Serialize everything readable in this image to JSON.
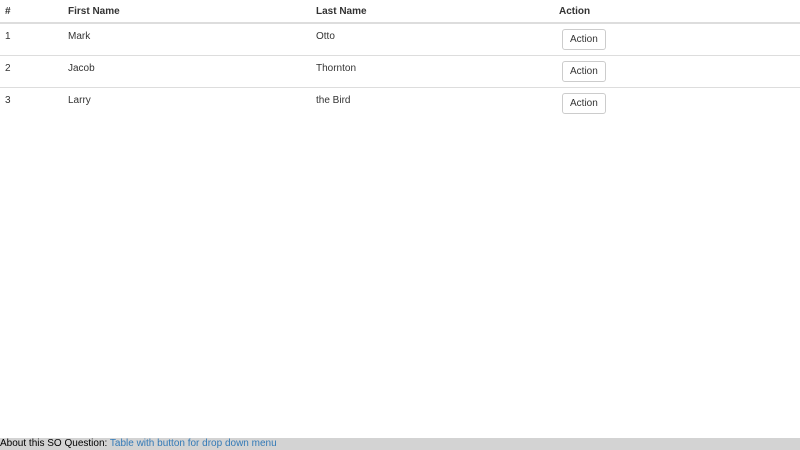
{
  "table": {
    "headers": {
      "number": "#",
      "first_name": "First Name",
      "last_name": "Last Name",
      "action": "Action"
    },
    "rows": [
      {
        "number": "1",
        "first_name": "Mark",
        "last_name": "Otto",
        "action_label": "Action"
      },
      {
        "number": "2",
        "first_name": "Jacob",
        "last_name": "Thornton",
        "action_label": "Action"
      },
      {
        "number": "3",
        "first_name": "Larry",
        "last_name": "the Bird",
        "action_label": "Action"
      }
    ]
  },
  "footer": {
    "prefix": "About this SO Question:",
    "link_text": "Table with button for drop down menu",
    "link_color": "#337ab7",
    "background": "#d3d3d3"
  }
}
